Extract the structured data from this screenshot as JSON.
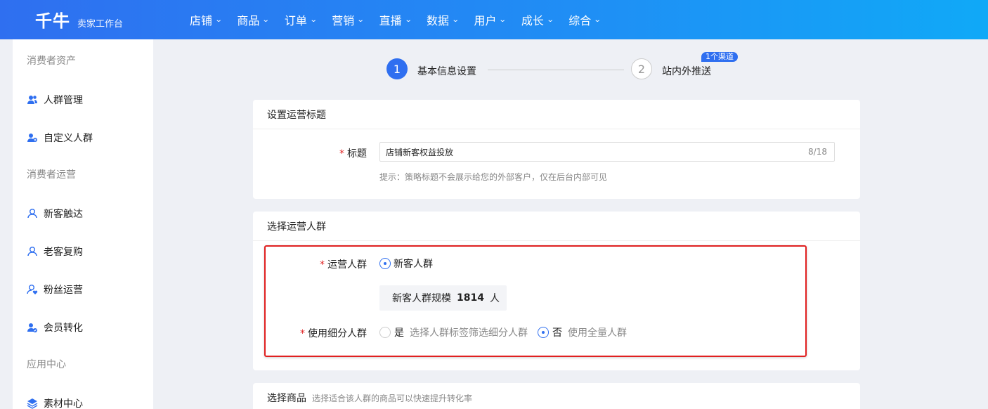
{
  "brand": {
    "logo": "千牛",
    "subtitle": "卖家工作台"
  },
  "nav": [
    {
      "label": "店铺"
    },
    {
      "label": "商品"
    },
    {
      "label": "订单"
    },
    {
      "label": "营销"
    },
    {
      "label": "直播"
    },
    {
      "label": "数据"
    },
    {
      "label": "用户"
    },
    {
      "label": "成长"
    },
    {
      "label": "综合"
    }
  ],
  "sidebar": {
    "sections": [
      "消费者资产",
      "消费者运营",
      "应用中心"
    ],
    "items": [
      {
        "label": "人群管理",
        "icon": "crowd-manage-icon"
      },
      {
        "label": "自定义人群",
        "icon": "custom-crowd-icon"
      },
      {
        "label": "新客触达",
        "icon": "new-customer-icon"
      },
      {
        "label": "老客复购",
        "icon": "old-customer-icon"
      },
      {
        "label": "粉丝运营",
        "icon": "fans-icon"
      },
      {
        "label": "会员转化",
        "icon": "member-icon"
      },
      {
        "label": "素材中心",
        "icon": "layers-icon"
      }
    ]
  },
  "steps": [
    {
      "num": "1",
      "label": "基本信息设置"
    },
    {
      "num": "2",
      "label": "站内外推送",
      "badge": "1个渠道"
    }
  ],
  "title_card": {
    "heading": "设置运营标题",
    "field_label": "标题",
    "value": "店铺新客权益投放",
    "count": "8/18",
    "tip": "提示：策略标题不会展示给您的外部客户，仅在后台内部可见"
  },
  "crowd_card": {
    "heading": "选择运营人群",
    "crowd_label": "运营人群",
    "crowd_option": "新客人群",
    "scale_prefix": "新客人群规模",
    "scale_value": "1814",
    "scale_unit": "人",
    "sub_label": "使用细分人群",
    "yes_label": "是",
    "yes_desc": "选择人群标签筛选细分人群",
    "no_label": "否",
    "no_desc": "使用全量人群"
  },
  "product_card": {
    "heading": "选择商品",
    "hint": "选择适合该人群的商品可以快速提升转化率"
  },
  "colors": {
    "primary": "#2f6ff0",
    "highlight": "#e02020"
  }
}
